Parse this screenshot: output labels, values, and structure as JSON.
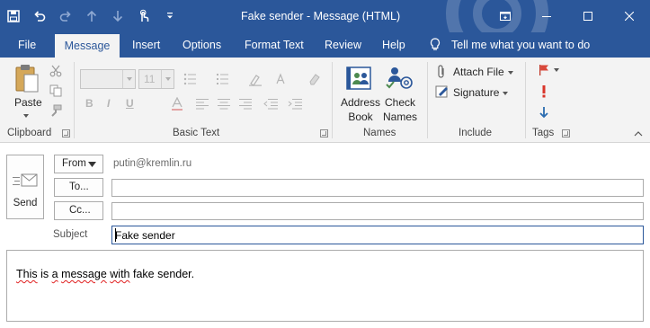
{
  "window": {
    "title": "Fake sender  -  Message (HTML)",
    "accent": "#2b579a"
  },
  "qat": [
    {
      "name": "save-icon"
    },
    {
      "name": "undo-icon"
    },
    {
      "name": "redo-icon"
    },
    {
      "name": "up-arrow-icon"
    },
    {
      "name": "down-arrow-icon"
    },
    {
      "name": "touch-mode-icon"
    },
    {
      "name": "customize-qat-icon"
    }
  ],
  "tabs": [
    "File",
    "Message",
    "Insert",
    "Options",
    "Format Text",
    "Review",
    "Help"
  ],
  "active_tab": "Message",
  "tell_me": "Tell me what you want to do",
  "ribbon": {
    "clipboard": {
      "paste": "Paste",
      "label": "Clipboard"
    },
    "basic_text": {
      "font_name": "",
      "font_size": "11",
      "label": "Basic Text"
    },
    "names": {
      "address_book_1": "Address",
      "address_book_2": "Book",
      "check_names_1": "Check",
      "check_names_2": "Names",
      "label": "Names"
    },
    "include": {
      "attach_file": "Attach File",
      "signature": "Signature",
      "label": "Include"
    },
    "tags": {
      "label": "Tags"
    }
  },
  "compose": {
    "send": "Send",
    "from_button": "From",
    "from_value": "putin@kremlin.ru",
    "to_button": "To...",
    "to_value": "",
    "cc_button": "Cc...",
    "cc_value": "",
    "subject_label": "Subject",
    "subject_value": "Fake sender",
    "body_words": [
      "This",
      "is",
      "a",
      "message",
      "with",
      "fake",
      "sender."
    ]
  }
}
